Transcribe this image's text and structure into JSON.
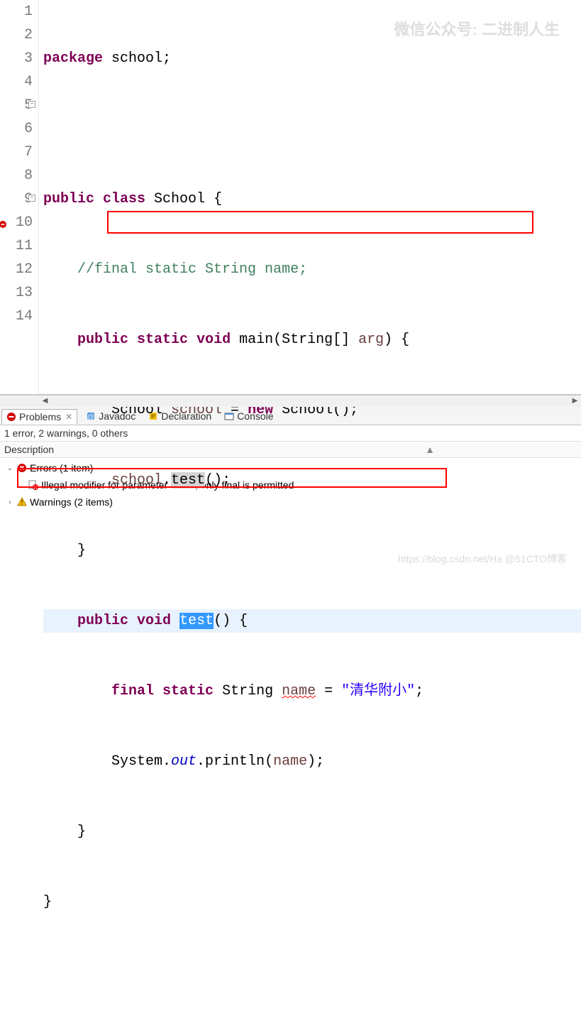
{
  "watermarks": {
    "top": "微信公众号: 二进制人生",
    "bottom": "https://blog.csdn.net/Ha  @51CTO博客"
  },
  "code": {
    "l1": {
      "kw1": "package",
      "txt": " school;"
    },
    "l3": {
      "kw1": "public",
      "kw2": "class",
      "cls": " School {"
    },
    "l4": {
      "cmt": "//final static String name;"
    },
    "l5": {
      "kw1": "public",
      "kw2": "static",
      "kw3": "void",
      "m": " main(String[] ",
      "arg": "arg",
      "end": ") {"
    },
    "l6": {
      "t1": "School ",
      "v": "school",
      "t2": " = ",
      "kw": "new",
      "t3": " School();"
    },
    "l7": {
      "v": "school",
      "dot": ".",
      "m": "test",
      "end": "();"
    },
    "l8": {
      "b": "}"
    },
    "l9": {
      "kw1": "public",
      "kw2": "void",
      "sp": " ",
      "m": "test",
      "end": "() {"
    },
    "l10": {
      "kw1": "final",
      "kw2": "static",
      "t1": " String ",
      "n": "name",
      "t2": " = ",
      "str": "\"清华附小\"",
      "end": ";"
    },
    "l11": {
      "t1": "System.",
      "out": "out",
      "t2": ".println(",
      "n": "name",
      "t3": ");"
    },
    "l12": {
      "b": "}"
    },
    "l13": {
      "b": "}"
    }
  },
  "gutter": {
    "1": "1",
    "2": "2",
    "3": "3",
    "4": "4",
    "5": "5",
    "6": "6",
    "7": "7",
    "8": "8",
    "9": "9",
    "10": "10",
    "11": "11",
    "12": "12",
    "13": "13",
    "14": "14"
  },
  "tabs": {
    "problems": "Problems",
    "javadoc": "Javadoc",
    "declaration": "Declaration",
    "console": "Console"
  },
  "summary": "1 error, 2 warnings, 0 others",
  "desc_header": "Description",
  "tree": {
    "errors_label": "Errors (1 item)",
    "error1": "Illegal modifier for parameter name; only final is permitted",
    "warnings_label": "Warnings (2 items)"
  },
  "sort_indicator": "▲"
}
